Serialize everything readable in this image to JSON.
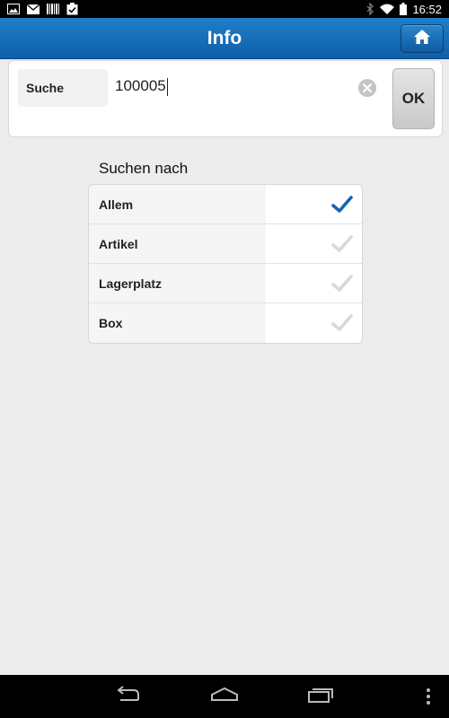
{
  "status_bar": {
    "time": "16:52",
    "left_icons": [
      "image-icon",
      "mail-icon",
      "barcode-icon",
      "clipboard-check-icon"
    ],
    "right_icons": [
      "bluetooth-icon",
      "wifi-icon",
      "battery-icon"
    ]
  },
  "header": {
    "title": "Info",
    "home_icon": "home-icon",
    "bg_color": "#1673bd"
  },
  "search": {
    "label": "Suche",
    "value": "100005",
    "clear_icon": "clear-icon",
    "ok_label": "OK"
  },
  "options": {
    "title": "Suchen nach",
    "items": [
      {
        "label": "Allem",
        "checked": true
      },
      {
        "label": "Artikel",
        "checked": false
      },
      {
        "label": "Lagerplatz",
        "checked": false
      },
      {
        "label": "Box",
        "checked": false
      }
    ],
    "checked_color": "#1565b5",
    "unchecked_color": "#d8d8d8"
  },
  "nav_bar": {
    "buttons": [
      "back-icon",
      "home-icon",
      "recent-apps-icon",
      "overflow-menu-icon"
    ]
  }
}
